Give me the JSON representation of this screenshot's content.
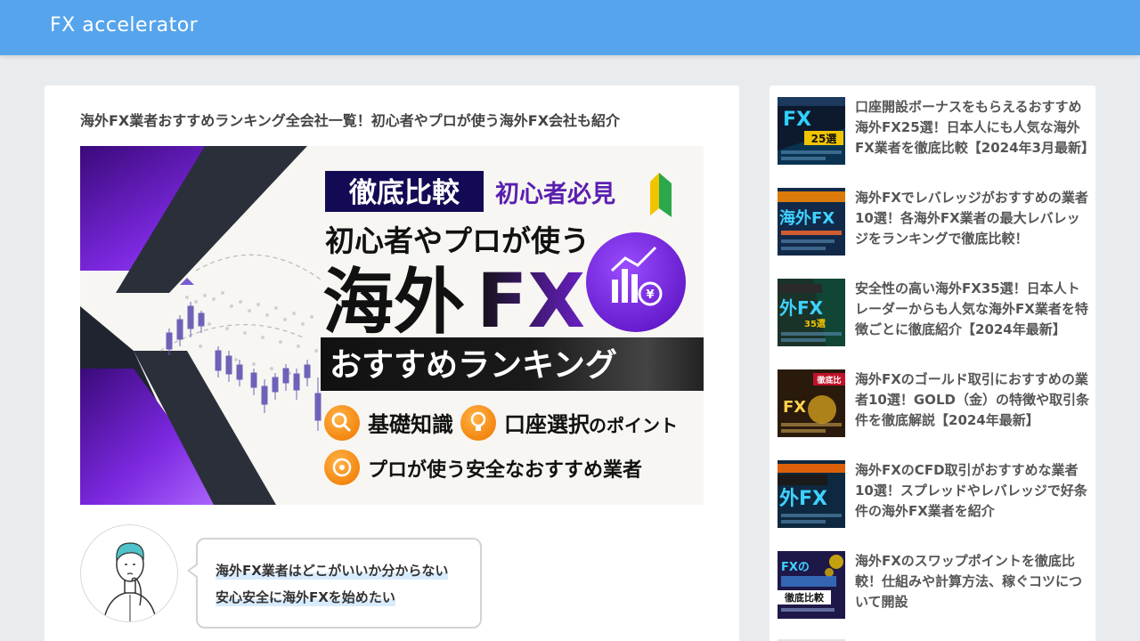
{
  "header": {
    "logo": "FX accelerator",
    "bg_color": "#56a4ec"
  },
  "article": {
    "title": "海外FX業者おすすめランキング全会社一覧！初心者やプロが使う海外FX会社も紹介",
    "hero": {
      "tag_compare": "徹底比較",
      "tag_beginner": "初心者必見",
      "subtitle": "初心者やプロが使う",
      "main_jp": "海外",
      "main_en": "FX",
      "ranking": "おすすめランキング",
      "point1": "基礎知識",
      "point2_main": "口座選択",
      "point2_suffix": "のポイント",
      "point3": "プロが使う安全なおすすめ業者",
      "icon_names": [
        "magnifier-icon",
        "lightbulb-icon",
        "target-icon",
        "chart-yen-icon",
        "beginner-mark-icon"
      ]
    },
    "speech": {
      "line1": "海外FX業者はどこがいいか分からない",
      "line2": "安心安全に海外FXを始めたい"
    }
  },
  "sidebar": {
    "items": [
      {
        "title": "口座開設ボーナスをもらえるおすすめ海外FX25選！日本人にも人気な海外FX業者を徹底比較【2024年3月最新】",
        "thumb_main": "FX",
        "thumb_sub": "25選",
        "thumb_bg": "#0d1a2e"
      },
      {
        "title": "海外FXでレバレッジがおすすめの業者10選！各海外FX業者の最大レバレッジをランキングで徹底比較！",
        "thumb_main": "海外FX",
        "thumb_sub": "",
        "thumb_bg": "#122a4a"
      },
      {
        "title": "安全性の高い海外FX35選！日本人トレーダーからも人気な海外FX業者を特徴ごとに徹底紹介【2024年最新】",
        "thumb_main": "外FX",
        "thumb_sub": "35選",
        "thumb_bg": "#1a3328"
      },
      {
        "title": "海外FXのゴールド取引におすすめの業者10選！GOLD（金）の特徴や取引条件を徹底解説【2024年最新】",
        "thumb_main": "FX",
        "thumb_sub": "徹底比",
        "thumb_bg": "#2a1a0c"
      },
      {
        "title": "海外FXのCFD取引がおすすめな業者10選！スプレッドやレバレッジで好条件の海外FX業者を紹介",
        "thumb_main": "外FX",
        "thumb_sub": "",
        "thumb_bg": "#0e2840"
      },
      {
        "title": "海外FXのスワップポイントを徹底比較！仕組みや計算方法、稼ぐコツについて開設",
        "thumb_main": "FXの",
        "thumb_sub": "徹底比較",
        "thumb_bg": "#1e1848"
      }
    ]
  }
}
